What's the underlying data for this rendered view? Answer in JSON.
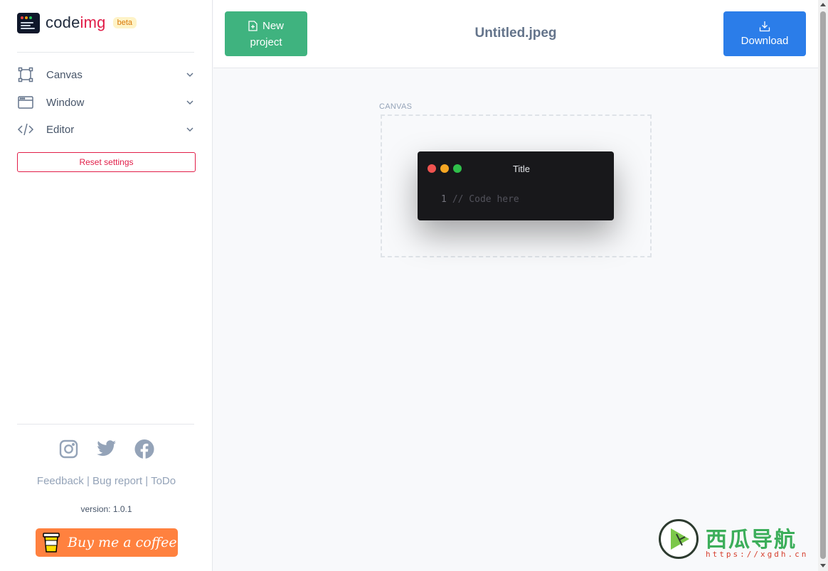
{
  "brand": {
    "name_part1": "code",
    "name_part2": "img",
    "badge": "beta"
  },
  "sidebar": {
    "menu": [
      {
        "label": "Canvas",
        "icon": "canvas-frame-icon"
      },
      {
        "label": "Window",
        "icon": "window-icon"
      },
      {
        "label": "Editor",
        "icon": "code-brackets-icon"
      }
    ],
    "reset_label": "Reset settings",
    "socials": [
      "instagram-icon",
      "twitter-icon",
      "facebook-icon"
    ],
    "links": {
      "feedback": "Feedback",
      "bug_report": "Bug report",
      "todo": "ToDo",
      "separator": "|"
    },
    "version": "version: 1.0.1",
    "coffee_label": "Buy me a coffee"
  },
  "header": {
    "new_project_line1": "New",
    "new_project_line2": "project",
    "file_title": "Untitled.jpeg",
    "download_label": "Download"
  },
  "canvas": {
    "label": "CANVAS",
    "window_title": "Title",
    "line_number": "1",
    "code_placeholder": "// Code here"
  },
  "watermark": {
    "text": "西瓜导航",
    "url": "https://xgdh.cn"
  },
  "colors": {
    "accent_green": "#3fb37f",
    "accent_blue": "#2b7de9",
    "accent_red": "#e11d48",
    "traffic_red": "#ef4444",
    "traffic_yellow": "#f59e0b",
    "traffic_green": "#22c55e",
    "coffee_orange": "#ff813f"
  }
}
